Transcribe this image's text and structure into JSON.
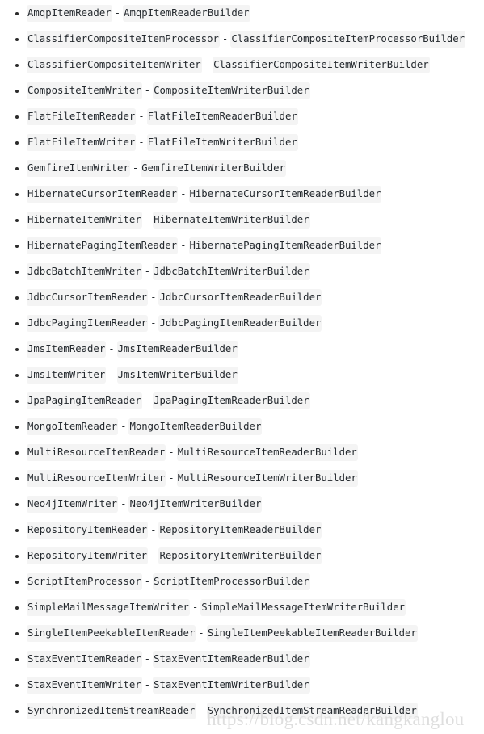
{
  "page": {
    "background_color": "#ffffff",
    "text_color": "#24292e",
    "code_background_color": "#f4f4f4",
    "bullet_color": "#2b2b2b",
    "separator": "-"
  },
  "list": {
    "marker": "bullet",
    "items": [
      {
        "component": "AmqpItemReader",
        "builder": "AmqpItemReaderBuilder"
      },
      {
        "component": "ClassifierCompositeItemProcessor",
        "builder": "ClassifierCompositeItemProcessorBuilder"
      },
      {
        "component": "ClassifierCompositeItemWriter",
        "builder": "ClassifierCompositeItemWriterBuilder"
      },
      {
        "component": "CompositeItemWriter",
        "builder": "CompositeItemWriterBuilder"
      },
      {
        "component": "FlatFileItemReader",
        "builder": "FlatFileItemReaderBuilder"
      },
      {
        "component": "FlatFileItemWriter",
        "builder": "FlatFileItemWriterBuilder"
      },
      {
        "component": "GemfireItemWriter",
        "builder": "GemfireItemWriterBuilder"
      },
      {
        "component": "HibernateCursorItemReader",
        "builder": "HibernateCursorItemReaderBuilder"
      },
      {
        "component": "HibernateItemWriter",
        "builder": "HibernateItemWriterBuilder"
      },
      {
        "component": "HibernatePagingItemReader",
        "builder": "HibernatePagingItemReaderBuilder"
      },
      {
        "component": "JdbcBatchItemWriter",
        "builder": "JdbcBatchItemWriterBuilder"
      },
      {
        "component": "JdbcCursorItemReader",
        "builder": "JdbcCursorItemReaderBuilder"
      },
      {
        "component": "JdbcPagingItemReader",
        "builder": "JdbcPagingItemReaderBuilder"
      },
      {
        "component": "JmsItemReader",
        "builder": "JmsItemReaderBuilder"
      },
      {
        "component": "JmsItemWriter",
        "builder": "JmsItemWriterBuilder"
      },
      {
        "component": "JpaPagingItemReader",
        "builder": "JpaPagingItemReaderBuilder"
      },
      {
        "component": "MongoItemReader",
        "builder": "MongoItemReaderBuilder"
      },
      {
        "component": "MultiResourceItemReader",
        "builder": "MultiResourceItemReaderBuilder"
      },
      {
        "component": "MultiResourceItemWriter",
        "builder": "MultiResourceItemWriterBuilder"
      },
      {
        "component": "Neo4jItemWriter",
        "builder": "Neo4jItemWriterBuilder"
      },
      {
        "component": "RepositoryItemReader",
        "builder": "RepositoryItemReaderBuilder"
      },
      {
        "component": "RepositoryItemWriter",
        "builder": "RepositoryItemWriterBuilder"
      },
      {
        "component": "ScriptItemProcessor",
        "builder": "ScriptItemProcessorBuilder"
      },
      {
        "component": "SimpleMailMessageItemWriter",
        "builder": "SimpleMailMessageItemWriterBuilder"
      },
      {
        "component": "SingleItemPeekableItemReader",
        "builder": "SingleItemPeekableItemReaderBuilder"
      },
      {
        "component": "StaxEventItemReader",
        "builder": "StaxEventItemReaderBuilder"
      },
      {
        "component": "StaxEventItemWriter",
        "builder": "StaxEventItemWriterBuilder"
      },
      {
        "component": "SynchronizedItemStreamReader",
        "builder": "SynchronizedItemStreamReaderBuilder"
      }
    ]
  },
  "watermark": {
    "text": "https://blog.csdn.net/kangkanglou",
    "color": "#dedede"
  }
}
